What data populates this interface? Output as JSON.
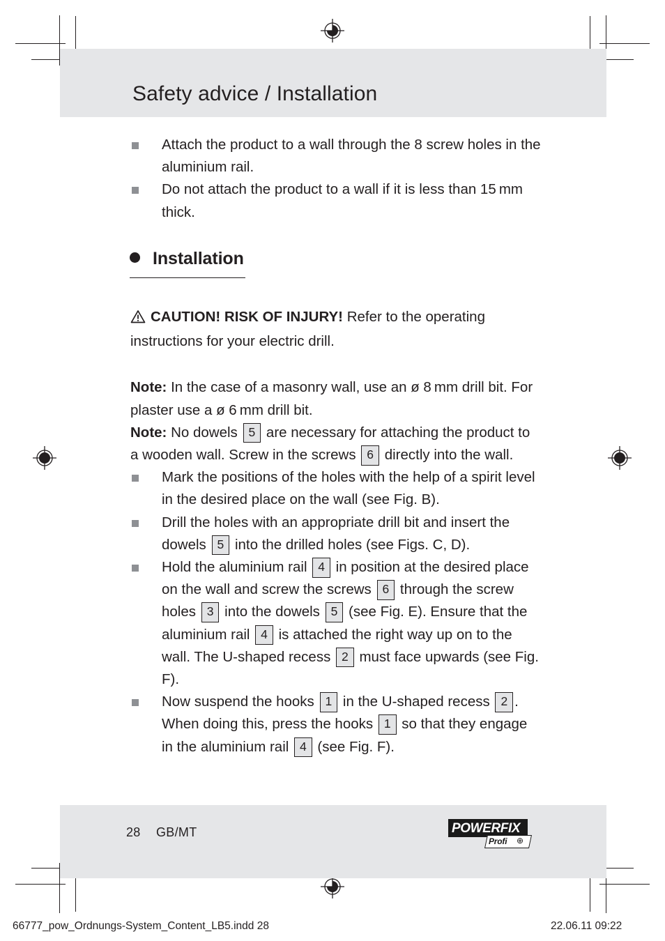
{
  "page": {
    "header_title": "Safety advice / Installation",
    "footer_page_number": "28",
    "footer_language": "GB/MT",
    "imprint_file": "66777_pow_Ordnungs-System_Content_LB5.indd   28",
    "imprint_date": "22.06.11   09:22",
    "band_color": "#e5e6e8",
    "text_color": "#231f20",
    "bullet_color": "#8e9094"
  },
  "brand": {
    "name": "POWERFIX",
    "trademark": "’",
    "sub_label": "Profi",
    "sub_mark": "⊕"
  },
  "content": {
    "top_bullets": [
      "Attach the product to a wall through the 8 screw holes in the aluminium rail.",
      "Do not attach the product to a wall if it is less than 15 mm thick."
    ],
    "section_heading": "Installation",
    "caution": {
      "label": "CAUTION! RISK OF INJURY!",
      "body": " Refer to the operating instructions for your electric drill."
    },
    "note1": {
      "label": "Note:",
      "body": " In the case of a masonry wall, use an ø 8 mm drill bit. For plaster use a ø 6 mm drill bit."
    },
    "note2": {
      "label": "Note:",
      "part1": " No dowels ",
      "ref1": "5",
      "part2": " are necessary for attaching the product to a wooden wall. Screw in the screws ",
      "ref2": "6",
      "part3": " directly into the wall."
    },
    "install_steps": [
      {
        "segments": [
          {
            "text": "Mark the positions of the holes with the help of a spirit level in the desired place on the wall (see Fig. B)."
          }
        ]
      },
      {
        "segments": [
          {
            "text": "Drill the holes with an appropriate drill bit and insert the dowels "
          },
          {
            "ref": "5"
          },
          {
            "text": " into the drilled holes (see Figs. C, D)."
          }
        ]
      },
      {
        "segments": [
          {
            "text": "Hold the aluminium rail "
          },
          {
            "ref": "4"
          },
          {
            "text": " in position at the desired place on the wall and screw the screws "
          },
          {
            "ref": "6"
          },
          {
            "text": " through the screw holes "
          },
          {
            "ref": "3"
          },
          {
            "text": " into the dowels "
          },
          {
            "ref": "5"
          },
          {
            "text": " (see Fig. E). Ensure that the aluminium rail "
          },
          {
            "ref": "4"
          },
          {
            "text": " is attached the right way up on to the wall. The U-shaped recess "
          },
          {
            "ref": "2"
          },
          {
            "text": " must face upwards (see Fig. F)."
          }
        ]
      },
      {
        "segments": [
          {
            "text": "Now suspend the hooks "
          },
          {
            "ref": "1"
          },
          {
            "text": " in the U-shaped recess "
          },
          {
            "ref": "2"
          },
          {
            "text": ". When doing this, press the hooks "
          },
          {
            "ref": "1"
          },
          {
            "text": " so that they engage in the aluminium rail "
          },
          {
            "ref": "4"
          },
          {
            "text": " (see Fig. F)."
          }
        ]
      }
    ]
  }
}
